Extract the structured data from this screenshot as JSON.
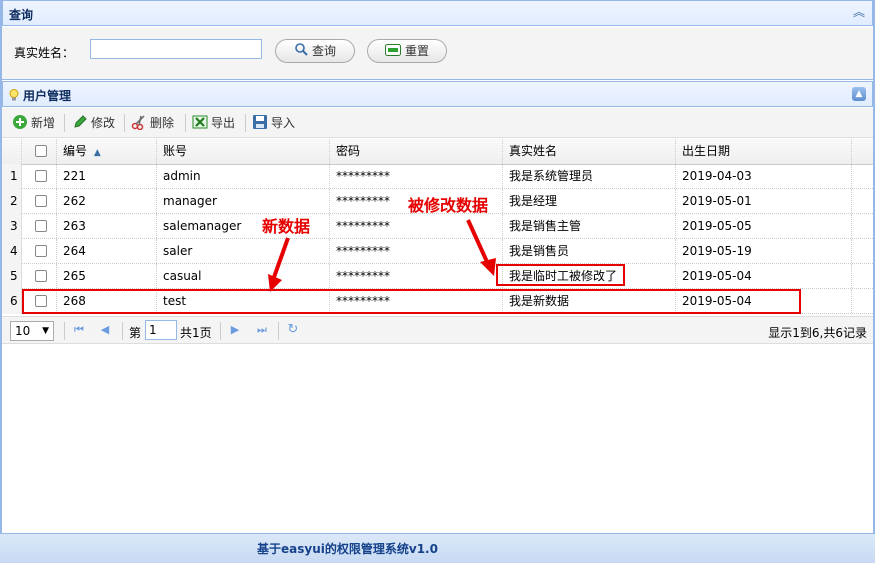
{
  "query_panel": {
    "title": "查询",
    "name_label": "真实姓名：",
    "name_value": "",
    "search_label": "查询",
    "reset_label": "重置"
  },
  "user_panel": {
    "title": "用户管理"
  },
  "toolbar": {
    "add_label": "新增",
    "edit_label": "修改",
    "delete_label": "删除",
    "export_label": "导出",
    "import_label": "导入"
  },
  "grid": {
    "columns": [
      "编号",
      "账号",
      "密码",
      "真实姓名",
      "出生日期"
    ],
    "rows": [
      {
        "rn": "1",
        "id": "221",
        "account": "admin",
        "password": "*********",
        "real_name": "我是系统管理员",
        "birth": "2019-04-03"
      },
      {
        "rn": "2",
        "id": "262",
        "account": "manager",
        "password": "*********",
        "real_name": "我是经理",
        "birth": "2019-05-01"
      },
      {
        "rn": "3",
        "id": "263",
        "account": "salemanager",
        "password": "*********",
        "real_name": "我是销售主管",
        "birth": "2019-05-05"
      },
      {
        "rn": "4",
        "id": "264",
        "account": "saler",
        "password": "*********",
        "real_name": "我是销售员",
        "birth": "2019-05-19"
      },
      {
        "rn": "5",
        "id": "265",
        "account": "casual",
        "password": "*********",
        "real_name": "我是临时工被修改了",
        "birth": "2019-05-04"
      },
      {
        "rn": "6",
        "id": "268",
        "account": "test",
        "password": "*********",
        "real_name": "我是新数据",
        "birth": "2019-05-04"
      }
    ]
  },
  "pager": {
    "page_size": "10",
    "page_prefix": "第",
    "page_number": "1",
    "page_total": "共1页",
    "info": "显示1到6,共6记录"
  },
  "annotations": {
    "new_data": "新数据",
    "modified_data": "被修改数据"
  },
  "footer": {
    "text": "基于easyui的权限管理系统v1.0"
  },
  "colors": {
    "panel_border": "#95b8e7",
    "title_text": "#0e2d5f",
    "annotation": "#e60000",
    "footer_text": "#15428b"
  }
}
